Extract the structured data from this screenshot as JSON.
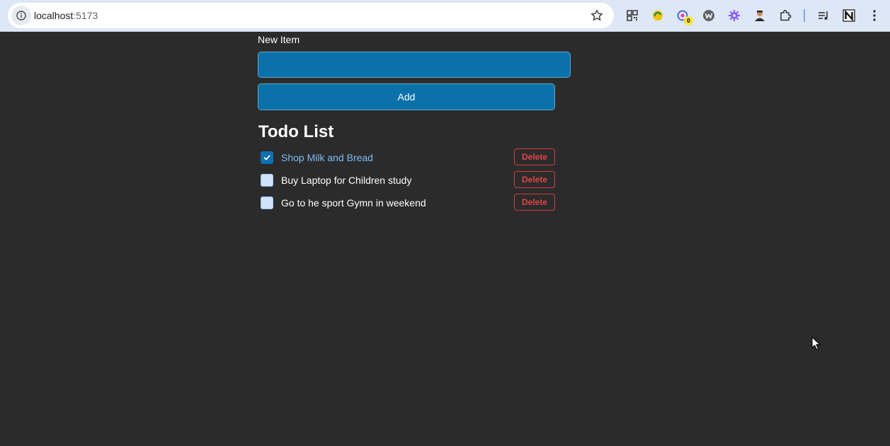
{
  "browser": {
    "url_host": "localhost",
    "url_port": ":5173"
  },
  "extensions": {
    "badge_count": "0"
  },
  "form": {
    "label": "New Item",
    "input_value": "",
    "add_label": "Add"
  },
  "list": {
    "heading": "Todo List",
    "delete_label": "Delete",
    "items": [
      {
        "text": "Shop Milk and Bread",
        "completed": true
      },
      {
        "text": "Buy Laptop for Children study",
        "completed": false
      },
      {
        "text": "Go to he sport Gymn in weekend",
        "completed": false
      }
    ]
  },
  "colors": {
    "background": "#2b2b2b",
    "accent": "#0a71a9",
    "completed_text": "#7bbcf5",
    "delete": "#e24545"
  }
}
